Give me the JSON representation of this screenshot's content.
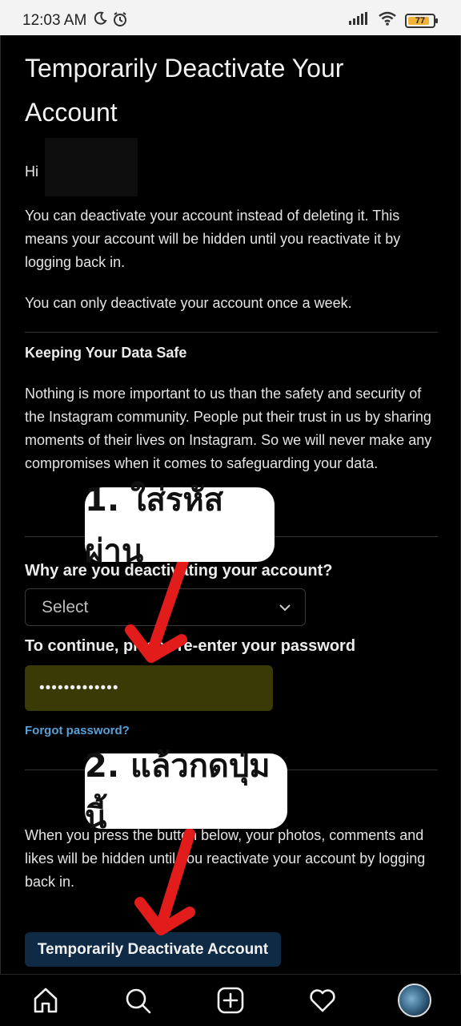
{
  "status_bar": {
    "time": "12:03 AM",
    "battery": "77",
    "icons": [
      "moon-icon",
      "alarm-icon",
      "signal-icon",
      "wifi-icon",
      "battery-icon"
    ]
  },
  "page": {
    "title": "Temporarily Deactivate Your Account",
    "greeting": "Hi",
    "intro": "You can deactivate your account instead of deleting it. This means your account will be hidden until you reactivate it by logging back in.",
    "once_week": "You can only deactivate your account once a week.",
    "data_safe_heading": "Keeping Your Data Safe",
    "data_safe_text": "Nothing is more important to us than the safety and security of the Instagram community. People put their trust in us by sharing moments of their lives on Instagram. So we will never make any compromises when it comes to safeguarding your data.",
    "reason_label": "Why are you deactivating your account?",
    "reason_select_value": "Select",
    "password_label": "To continue, please re-enter your password",
    "password_value": "•••••••••••••",
    "forgot_password": "Forgot password?",
    "final_note": "When you press the button below, your photos, comments and likes will be hidden until you reactivate your account by logging back in.",
    "deactivate_button": "Temporarily Deactivate Account"
  },
  "annotations": {
    "step1": "1. ใส่รหัสผ่าน",
    "step2": "2. แล้วกดปุ่มนี้",
    "arrow_color": "#e21b1b"
  },
  "bottom_nav": [
    "home-icon",
    "search-icon",
    "new-post-icon",
    "activity-heart-icon",
    "profile-avatar"
  ],
  "colors": {
    "background": "#000000",
    "link": "#5aa0d8",
    "button": "#0f2a44",
    "password_fill": "#3a3a07"
  }
}
